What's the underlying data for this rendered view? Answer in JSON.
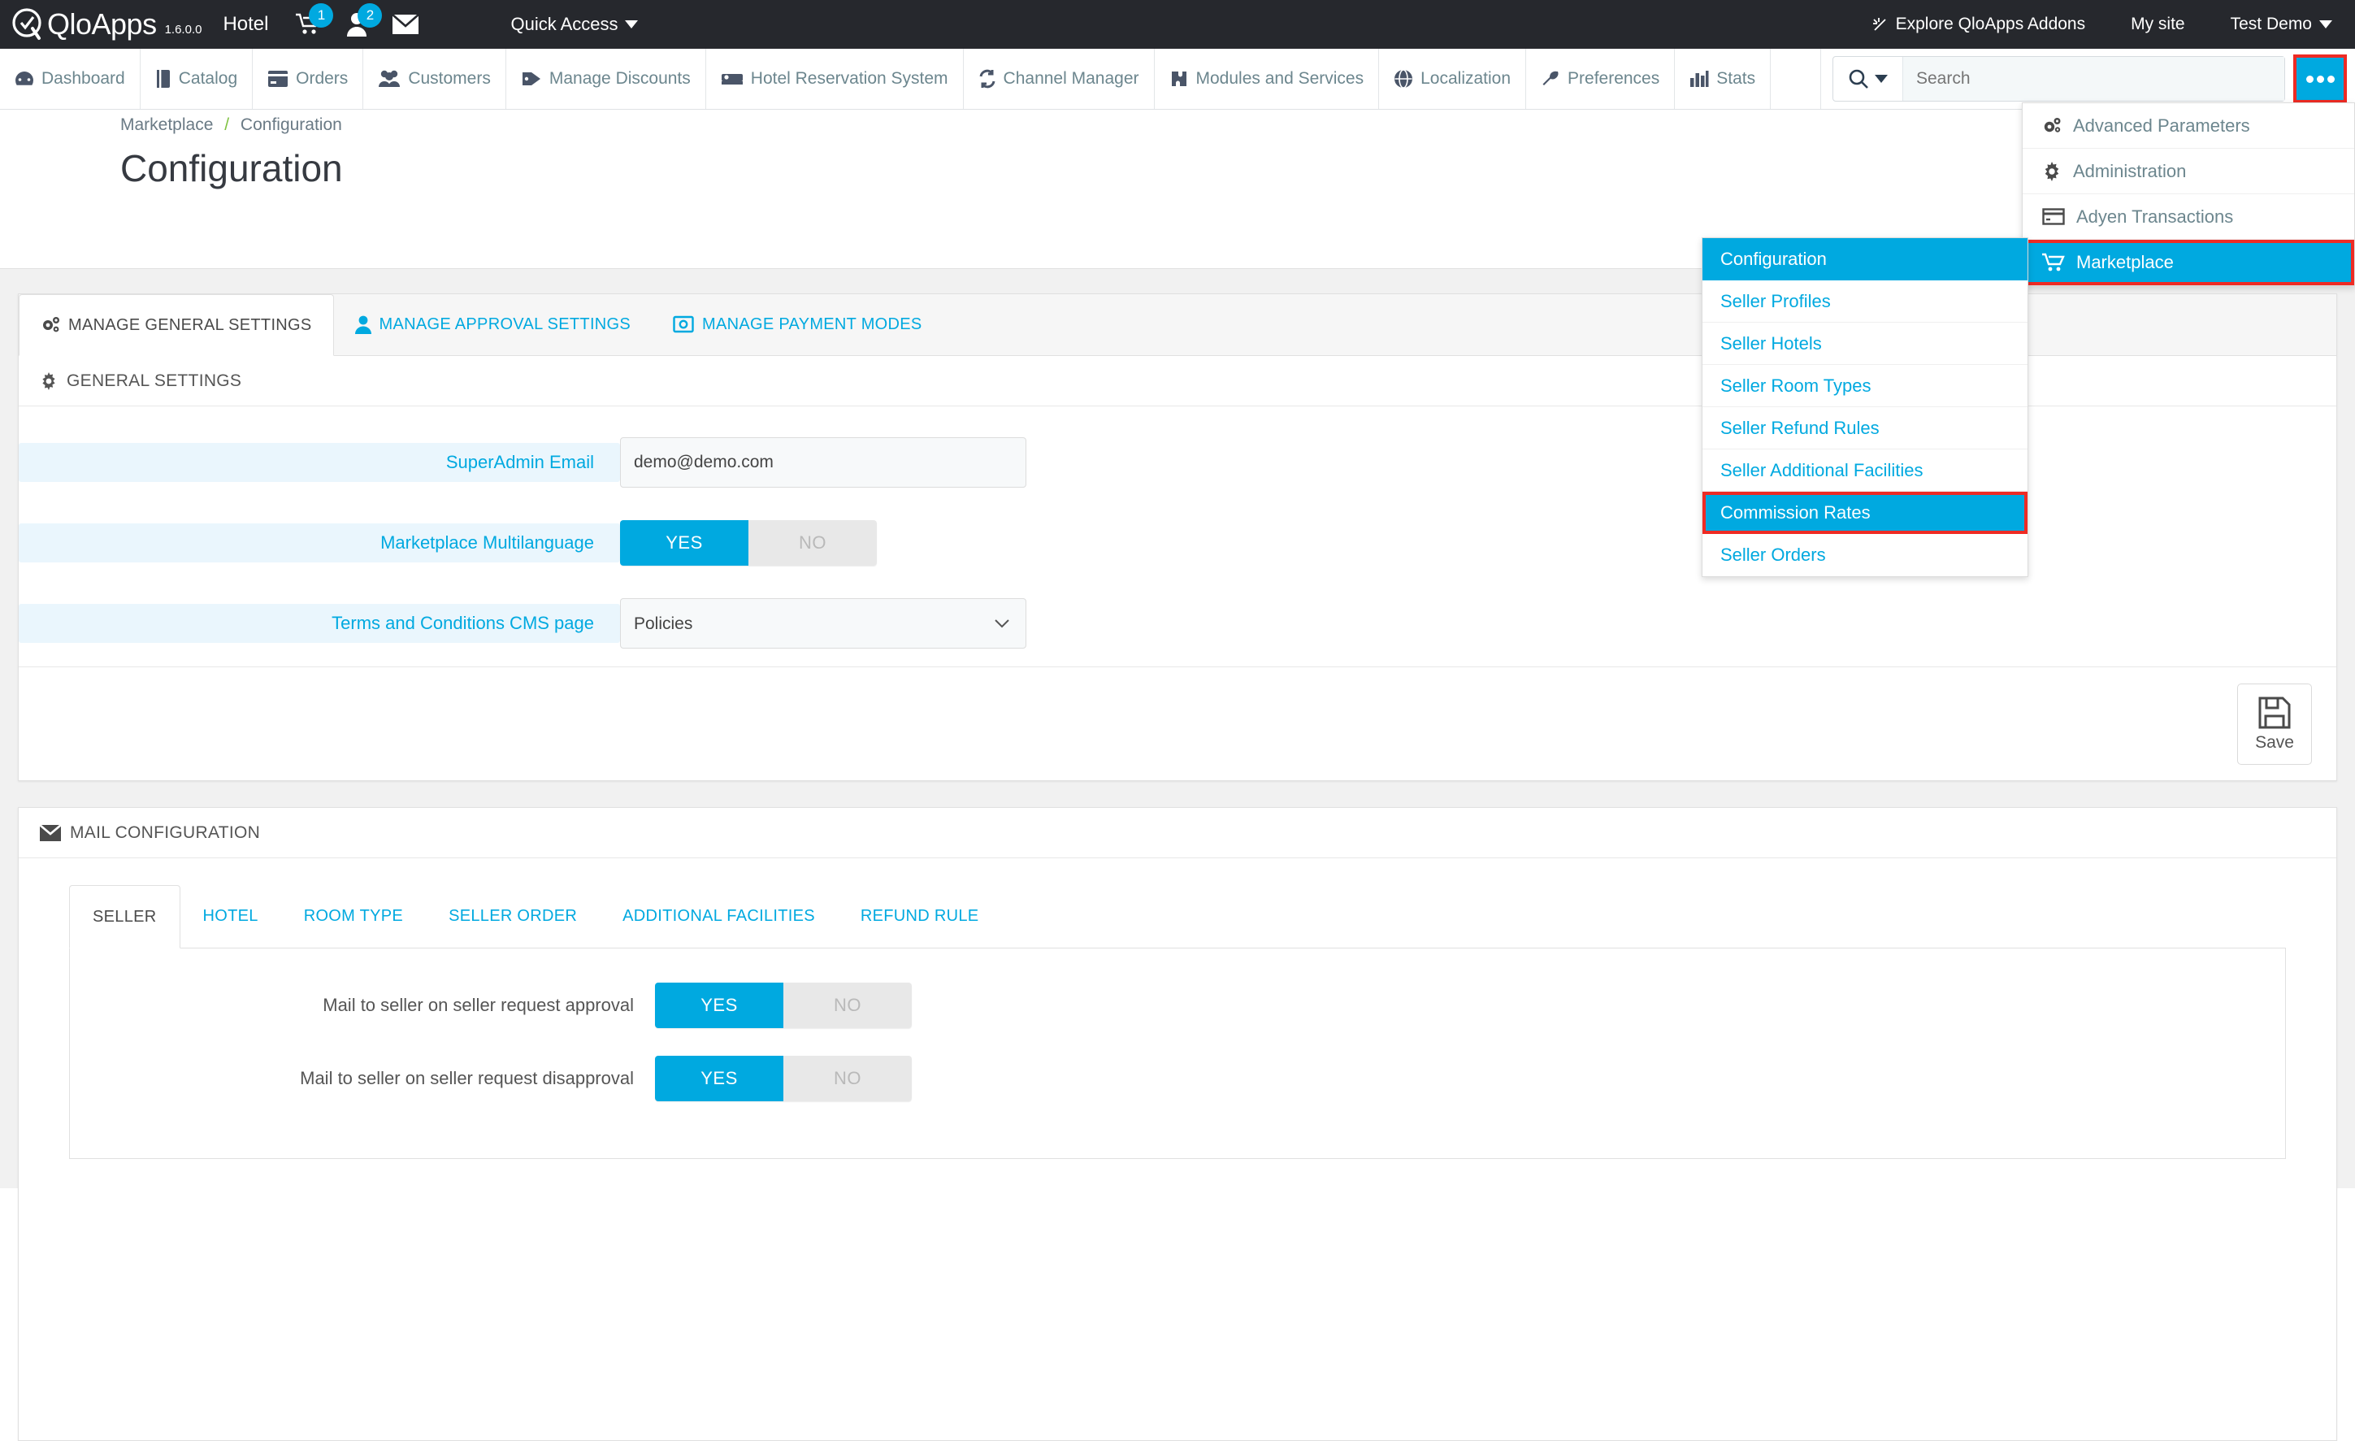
{
  "topbar": {
    "brand": "QloApps",
    "version": "1.6.0.0",
    "shop_label": "Hotel",
    "cart_badge": "1",
    "customers_badge": "2",
    "quick_access": "Quick Access",
    "addons_link": "Explore QloApps Addons",
    "my_site": "My site",
    "employee": "Test Demo"
  },
  "mainnav": {
    "items": [
      {
        "label": "Dashboard",
        "icon": "dashboard-icon"
      },
      {
        "label": "Catalog",
        "icon": "book-icon"
      },
      {
        "label": "Orders",
        "icon": "orders-icon"
      },
      {
        "label": "Customers",
        "icon": "customers-icon"
      },
      {
        "label": "Manage Discounts",
        "icon": "tag-icon"
      },
      {
        "label": "Hotel Reservation System",
        "icon": "bed-icon"
      },
      {
        "label": "Channel Manager",
        "icon": "refresh-icon"
      },
      {
        "label": "Modules and Services",
        "icon": "puzzle-icon"
      },
      {
        "label": "Localization",
        "icon": "globe-icon"
      },
      {
        "label": "Preferences",
        "icon": "wrench-icon"
      },
      {
        "label": "Stats",
        "icon": "bars-icon"
      }
    ],
    "search_placeholder": "Search",
    "search_value": "",
    "more_button": "..."
  },
  "breadcrumb": {
    "parent": "Marketplace",
    "separator": "/",
    "current": "Configuration"
  },
  "page_title": "Configuration",
  "tabs": [
    {
      "label": "MANAGE GENERAL SETTINGS",
      "icon": "gears-icon",
      "active": true
    },
    {
      "label": "MANAGE APPROVAL SETTINGS",
      "icon": "user-icon",
      "active": false
    },
    {
      "label": "MANAGE PAYMENT MODES",
      "icon": "money-icon",
      "active": false
    }
  ],
  "general_settings": {
    "heading": "GENERAL SETTINGS",
    "heading_icon": "gear-icon",
    "fields": [
      {
        "label": "SuperAdmin Email",
        "type": "text",
        "value": "demo@demo.com"
      },
      {
        "label": "Marketplace Multilanguage",
        "type": "switch",
        "yes": "YES",
        "no": "NO",
        "state": "yes"
      },
      {
        "label": "Terms and Conditions CMS page",
        "type": "select",
        "value": "Policies"
      }
    ],
    "save_label": "Save",
    "save_icon": "floppy-disk-icon"
  },
  "mail_configuration": {
    "heading": "MAIL CONFIGURATION",
    "heading_icon": "envelope-icon",
    "tabs": [
      {
        "label": "SELLER",
        "active": true
      },
      {
        "label": "HOTEL",
        "active": false
      },
      {
        "label": "ROOM TYPE",
        "active": false
      },
      {
        "label": "SELLER ORDER",
        "active": false
      },
      {
        "label": "ADDITIONAL FACILITIES",
        "active": false
      },
      {
        "label": "REFUND RULE",
        "active": false
      }
    ],
    "rows": [
      {
        "label": "Mail to seller on seller request approval",
        "yes": "YES",
        "no": "NO",
        "state": "yes"
      },
      {
        "label": "Mail to seller on seller request disapproval",
        "yes": "YES",
        "no": "NO",
        "state": "yes"
      }
    ]
  },
  "menu_main": {
    "items": [
      {
        "label": "Advanced Parameters",
        "icon": "gears-icon",
        "selected": false
      },
      {
        "label": "Administration",
        "icon": "gear-icon",
        "selected": false
      },
      {
        "label": "Adyen Transactions",
        "icon": "credit-card-icon",
        "selected": false
      },
      {
        "label": "Marketplace",
        "icon": "cart-icon",
        "selected": true
      }
    ]
  },
  "menu_sub": {
    "items": [
      {
        "label": "Configuration",
        "highlight": true,
        "boxed": false
      },
      {
        "label": "Seller Profiles",
        "highlight": false,
        "boxed": false
      },
      {
        "label": "Seller Hotels",
        "highlight": false,
        "boxed": false
      },
      {
        "label": "Seller Room Types",
        "highlight": false,
        "boxed": false
      },
      {
        "label": "Seller Refund Rules",
        "highlight": false,
        "boxed": false
      },
      {
        "label": "Seller Additional Facilities",
        "highlight": false,
        "boxed": false
      },
      {
        "label": "Commission Rates",
        "highlight": true,
        "boxed": true
      },
      {
        "label": "Seller Orders",
        "highlight": false,
        "boxed": false
      }
    ]
  },
  "colors": {
    "accent": "#00a9e0",
    "highlight_box": "#ee2b24",
    "topbar_bg": "#26282d",
    "content_bg": "#f1f1f1"
  }
}
